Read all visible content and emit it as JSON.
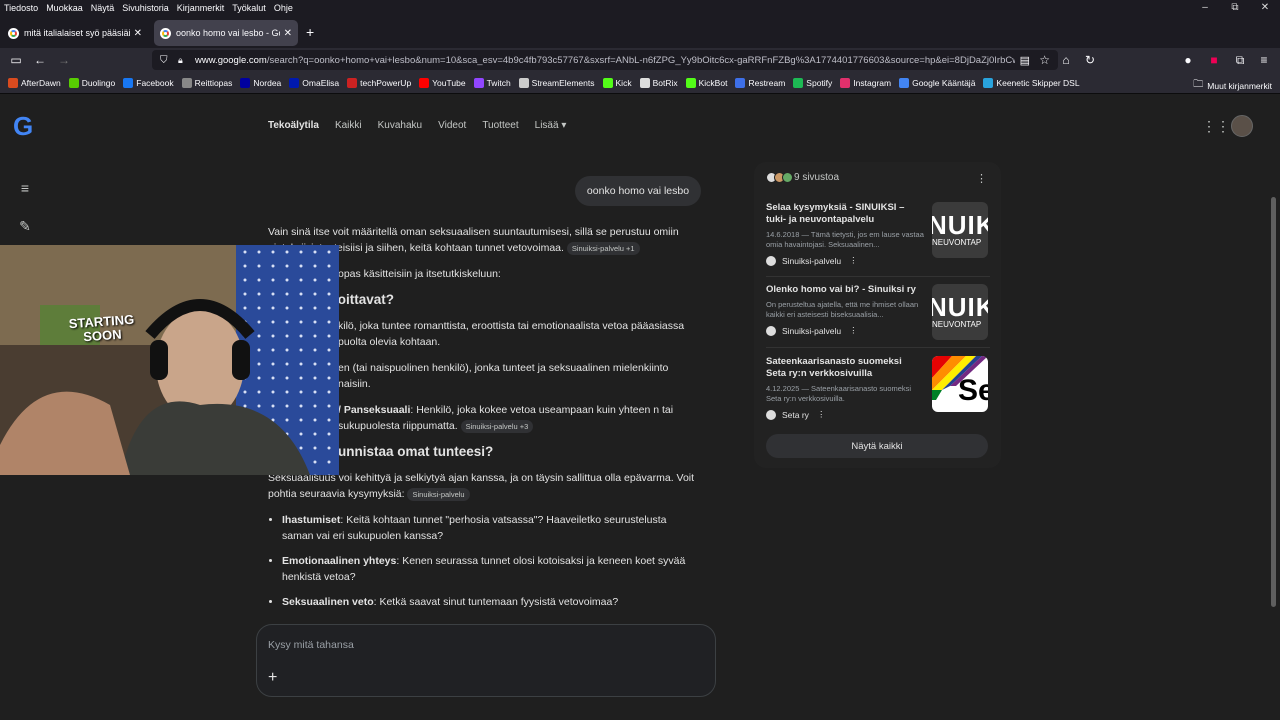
{
  "menu": [
    "Tiedosto",
    "Muokkaa",
    "Näytä",
    "Sivuhistoria",
    "Kirjanmerkit",
    "Työkalut",
    "Ohje"
  ],
  "window_controls": [
    "–",
    "⧉",
    "✕"
  ],
  "tabs": [
    {
      "title": "mitä italialaiset syö pääsiäisenä"
    },
    {
      "title": "oonko homo vai lesbo - Google"
    }
  ],
  "url": {
    "domain": "www.google.com",
    "rest": "/search?q=oonko+homo+vai+lesbo&num=10&sca_esv=4b9c4fb793c57767&sxsrf=ANbL-n6fZPG_Yy9bOitc6cx-gaRRFnFZBg%3A1774401776603&source=hp&ei=8DjDaZj0IrbCwPAP"
  },
  "bookmarks": [
    {
      "label": "AfterDawn",
      "color": "#d94b1f"
    },
    {
      "label": "Duolingo",
      "color": "#58cc02"
    },
    {
      "label": "Facebook",
      "color": "#1877f2"
    },
    {
      "label": "Reittiopas",
      "color": "#888888"
    },
    {
      "label": "Nordea",
      "color": "#0000a0"
    },
    {
      "label": "OmaElisa",
      "color": "#0019af"
    },
    {
      "label": "techPowerUp",
      "color": "#cc2222"
    },
    {
      "label": "YouTube",
      "color": "#ff0000"
    },
    {
      "label": "Twitch",
      "color": "#9146ff"
    },
    {
      "label": "StreamElements",
      "color": "#cccccc"
    },
    {
      "label": "Kick",
      "color": "#53fc18"
    },
    {
      "label": "BotRix",
      "color": "#dddddd"
    },
    {
      "label": "KickBot",
      "color": "#53fc18"
    },
    {
      "label": "Restream",
      "color": "#3e6fe8"
    },
    {
      "label": "Spotify",
      "color": "#1db954"
    },
    {
      "label": "Instagram",
      "color": "#e1306c"
    },
    {
      "label": "Google Kääntäjä",
      "color": "#4285f4"
    },
    {
      "label": "Keenetic Skipper DSL",
      "color": "#29a3dd"
    }
  ],
  "other_bookmarks": "Muut kirjanmerkit",
  "google_nav": [
    "Tekoälytila",
    "Kaikki",
    "Kuvahaku",
    "Videot",
    "Tuotteet",
    "Lisää"
  ],
  "user_query": "oonko homo vai lesbo",
  "answer": {
    "p1": "Vain sinä itse voit määritellä oman seksuaalisen suuntautumisesi, sillä se perustuu omiin ajatuksiisi, tunteisiisi ja siihen, keitä kohtaan tunnet vetovoimaa.",
    "p1_src": "Sinuiksi-palvelu +1",
    "p2": "opas käsitteisiin ja itsetutkiskeluun:",
    "h1": "tarkoittavat?",
    "b1_text": "kilö, joka tuntee romanttista, eroottista tai emotionaalista vetoa pääasiassa puolta olevia kohtaan.",
    "b2_text": "en (tai naispuolinen henkilö), jonka tunteet ja seksuaalinen mielenkiinto naisiin.",
    "b3_bold": "/ Panseksuaali",
    "b3_text": ": Henkilö, joka kokee vetoa useampaan kuin yhteen n tai sukupuolesta riippumatta.",
    "b3_src": "Sinuiksi-palvelu +3",
    "h2": "unnistaa omat tunteesi?",
    "p3": "Seksuaalisuus voi kehittyä ja selkiytyä ajan kanssa, ja on täysin sallittua olla epävarma. Voit pohtia seuraavia kysymyksiä:",
    "p3_src": "Sinuiksi-palvelu",
    "list": [
      {
        "bold": "Ihastumiset",
        "text": ": Keitä kohtaan tunnet \"perhosia vatsassa\"? Haaveiletko seurustelusta saman vai eri sukupuolen kanssa?"
      },
      {
        "bold": "Emotionaalinen yhteys",
        "text": ": Kenen seurassa tunnet olosi kotoisaksi ja keneen koet syvää henkistä vetoa?"
      },
      {
        "bold": "Seksuaalinen veto",
        "text": ": Ketkä saavat sinut tuntemaan fyysistä vetovoimaa?"
      }
    ]
  },
  "sources": {
    "header": "9 sivustoa",
    "cards": [
      {
        "title": "Selaa kysymyksiä - SINUIKSI – tuki- ja neuvontapalvelu",
        "desc": "14.6.2018 — Tämä tietysti, jos em lause vastaa omia havaintojasi. Seksuaalinen...",
        "site": "Sinuiksi-palvelu",
        "thumb_big": "NUIK",
        "thumb_small": "NEUVONTAP"
      },
      {
        "title": "Olenko homo vai bi? - Sinuiksi ry",
        "desc": "On perusteltua ajatella, että me ihmiset ollaan kaikki eri asteisesti biseksuaalisia...",
        "site": "Sinuiksi-palvelu",
        "thumb_big": "NUIK",
        "thumb_small": "NEUVONTAP"
      },
      {
        "title": "Sateenkaarisanasto suomeksi Seta ry:n verkkosivuilla",
        "desc": "4.12.2025 — Sateenkaarisanasto suomeksi Seta ry:n verkkosivuilla.",
        "site": "Seta ry",
        "thumb_big": "Se",
        "thumb_small": ""
      }
    ],
    "show_all": "Näytä kaikki"
  },
  "ask_placeholder": "Kysy mitä tahansa",
  "webcam": {
    "overlay_text": "STARTING SOON"
  }
}
